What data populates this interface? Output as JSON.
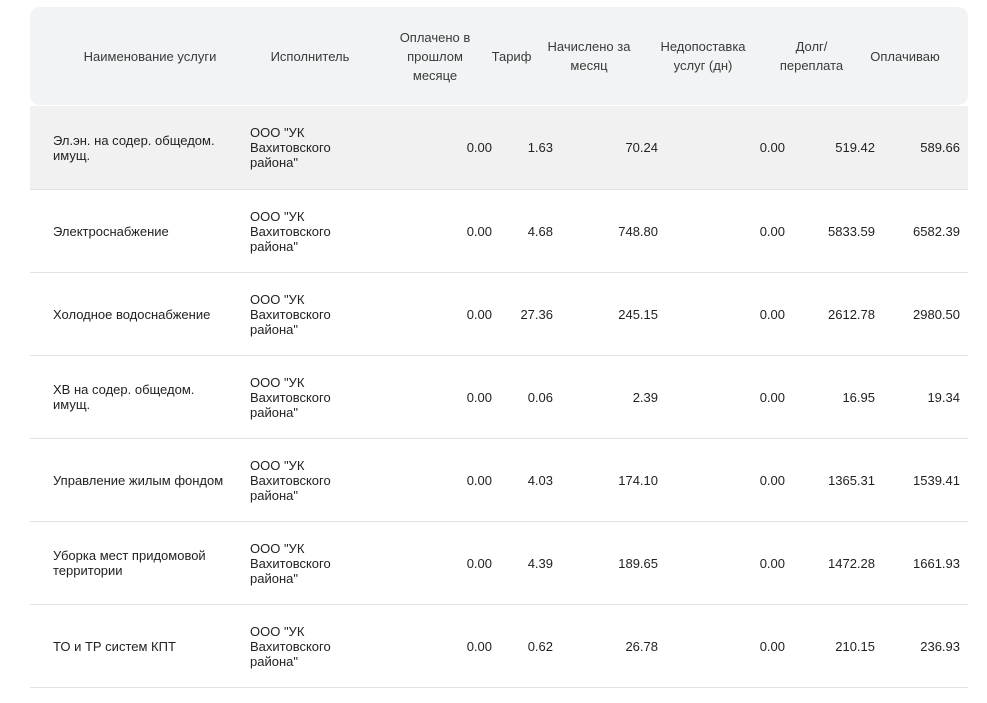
{
  "table": {
    "columns": [
      "Наименование услуги",
      "Исполнитель",
      "Оплачено в прошлом месяце",
      "Тариф",
      "Начислено за месяц",
      "Недопоставка услуг (дн)",
      "Долг/ переплата",
      "Оплачиваю"
    ],
    "rows": [
      {
        "name": "Эл.эн. на содер. общедом. имущ.",
        "executor": "ООО \"УК Вахитовского района\"",
        "paid_last_month": "0.00",
        "tariff": "1.63",
        "charged": "70.24",
        "shortfall": "0.00",
        "debt": "519.42",
        "paying": "589.66",
        "highlighted": true
      },
      {
        "name": "Электроснабжение",
        "executor": "ООО \"УК Вахитовского района\"",
        "paid_last_month": "0.00",
        "tariff": "4.68",
        "charged": "748.80",
        "shortfall": "0.00",
        "debt": "5833.59",
        "paying": "6582.39"
      },
      {
        "name": "Холодное водоснабжение",
        "executor": "ООО \"УК Вахитовского района\"",
        "paid_last_month": "0.00",
        "tariff": "27.36",
        "charged": "245.15",
        "shortfall": "0.00",
        "debt": "2612.78",
        "paying": "2980.50"
      },
      {
        "name": "ХВ на содер. общедом. имущ.",
        "executor": "ООО \"УК Вахитовского района\"",
        "paid_last_month": "0.00",
        "tariff": "0.06",
        "charged": "2.39",
        "shortfall": "0.00",
        "debt": "16.95",
        "paying": "19.34"
      },
      {
        "name": "Управление жилым фондом",
        "executor": "ООО \"УК Вахитовского района\"",
        "paid_last_month": "0.00",
        "tariff": "4.03",
        "charged": "174.10",
        "shortfall": "0.00",
        "debt": "1365.31",
        "paying": "1539.41"
      },
      {
        "name": "Уборка мест придомовой территории",
        "executor": "ООО \"УК Вахитовского района\"",
        "paid_last_month": "0.00",
        "tariff": "4.39",
        "charged": "189.65",
        "shortfall": "0.00",
        "debt": "1472.28",
        "paying": "1661.93"
      },
      {
        "name": "ТО и ТР систем КПТ",
        "executor": "ООО \"УК Вахитовского района\"",
        "paid_last_month": "0.00",
        "tariff": "0.62",
        "charged": "26.78",
        "shortfall": "0.00",
        "debt": "210.15",
        "paying": "236.93"
      }
    ]
  }
}
